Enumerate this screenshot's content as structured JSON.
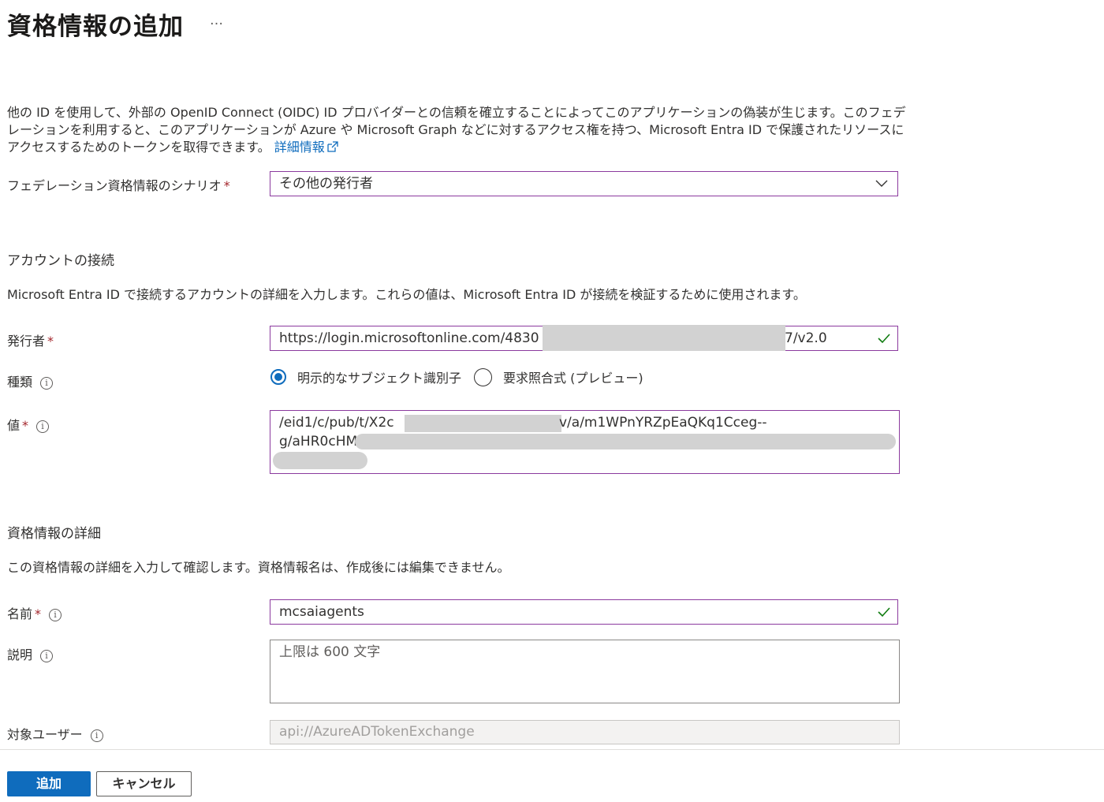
{
  "header": {
    "title": "資格情報の追加",
    "more_label": "…"
  },
  "intro": {
    "text": "他の ID を使用して、外部の OpenID Connect (OIDC) ID プロバイダーとの信頼を確立することによってこのアプリケーションの偽装が生じます。このフェデレーションを利用すると、このアプリケーションが Azure や Microsoft Graph などに対するアクセス権を持つ、Microsoft Entra ID で保護されたリソースにアクセスするためのトークンを取得できます。 ",
    "link": "詳細情報"
  },
  "scenario": {
    "label": "フェデレーション資格情報のシナリオ",
    "required": "*",
    "selected": "その他の発行者"
  },
  "account": {
    "heading": "アカウントの接続",
    "description": "Microsoft Entra ID で接続するアカウントの詳細を入力します。これらの値は、Microsoft Entra ID が接続を検証するために使用されます。",
    "issuer_label": "発行者",
    "issuer_required": "*",
    "issuer_prefix": "https://login.microsoftonline.com/4830",
    "issuer_suffix": "7/v2.0",
    "type_label": "種類",
    "type_options": [
      "明示的なサブジェクト識別子",
      "要求照合式 (プレビュー)"
    ],
    "value_label": "値",
    "value_required": "*",
    "value_line1_prefix": "/eid1/c/pub/t/X2c",
    "value_line1_suffix": "v/a/m1WPnYRZpEaQKq1Cceg--",
    "value_line2_prefix": "g/aHR0cHM"
  },
  "details": {
    "heading": "資格情報の詳細",
    "description": "この資格情報の詳細を入力して確認します。資格情報名は、作成後には編集できません。",
    "name_label": "名前",
    "name_required": "*",
    "name_value": "mcsaiagents",
    "desc_label": "説明",
    "desc_placeholder": "上限は 600 文字",
    "audience_label": "対象ユーザー",
    "audience_value": "api://AzureADTokenExchange"
  },
  "footer": {
    "add_label": "追加",
    "cancel_label": "キャンセル"
  },
  "colors": {
    "accent": "#0f6cbd",
    "field_border": "#8b3a9e",
    "required": "#a4262c",
    "valid": "#107c10"
  }
}
